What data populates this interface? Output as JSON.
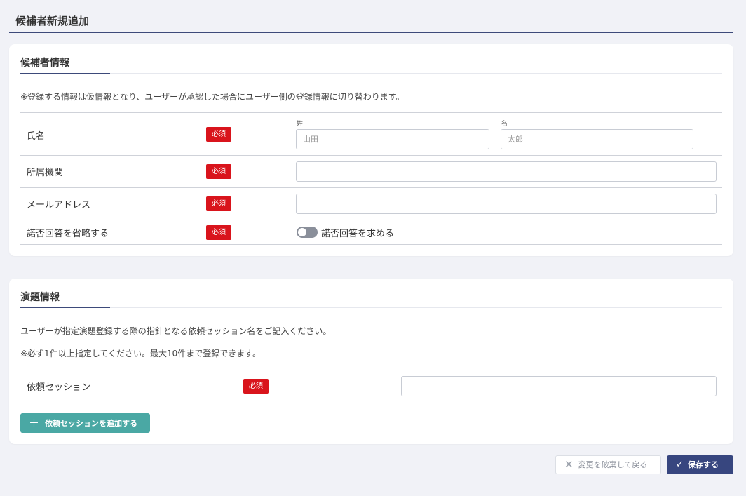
{
  "page": {
    "title": "候補者新規追加"
  },
  "candidate_info": {
    "title": "候補者情報",
    "note": "※登録する情報は仮情報となり、ユーザーが承認した場合にユーザー側の登録情報に切り替わります。",
    "required_label": "必須",
    "name_row": {
      "label": "氏名",
      "last_name_label": "姓",
      "last_name_placeholder": "山田",
      "first_name_label": "名",
      "first_name_placeholder": "太郎"
    },
    "affiliation_row": {
      "label": "所属機関",
      "value": ""
    },
    "email_row": {
      "label": "メールアドレス",
      "value": ""
    },
    "consent_row": {
      "label": "諾否回答を省略する",
      "toggle_label": "諾否回答を求める",
      "toggle_on": false
    }
  },
  "topic_info": {
    "title": "演題情報",
    "note_1": "ユーザーが指定演題登録する際の指針となる依頼セッション名をご記入ください。",
    "note_2": "※必ず1件以上指定してください。最大10件まで登録できます。",
    "required_label": "必須",
    "session_row": {
      "label": "依頼セッション",
      "value": ""
    },
    "add_button_label": "依頼セッションを追加する"
  },
  "footer": {
    "cancel_label": "変更を破棄して戻る",
    "save_label": "保存する"
  },
  "colors": {
    "accent": "#37467f",
    "required": "#d9141c",
    "add_button": "#4aa8a4"
  }
}
